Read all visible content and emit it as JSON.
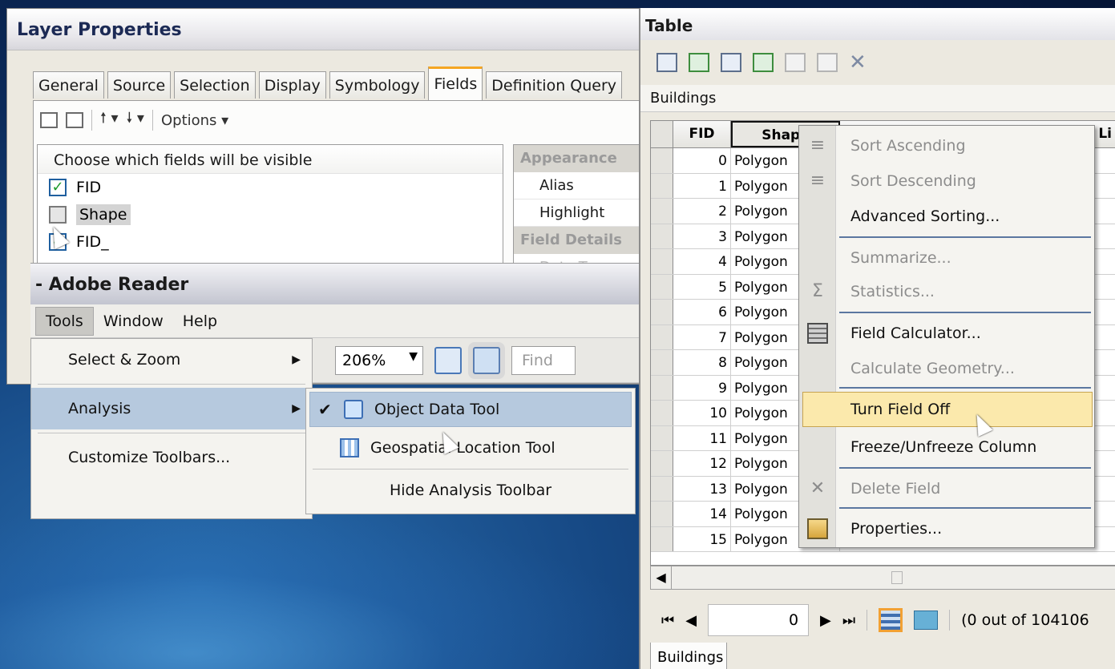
{
  "layer_properties": {
    "title": "Layer Properties",
    "tabs": [
      "General",
      "Source",
      "Selection",
      "Display",
      "Symbology",
      "Fields",
      "Definition Query"
    ],
    "active_tab": "Fields",
    "options_label": "Options ▾",
    "fields_header": "Choose which fields will be visible",
    "fields": [
      {
        "name": "FID",
        "checked": true
      },
      {
        "name": "Shape",
        "checked": false
      },
      {
        "name": "FID_",
        "checked": true
      }
    ],
    "props": {
      "appearance": "Appearance",
      "alias": "Alias",
      "highlight": "Highlight",
      "field_details": "Field Details",
      "data_type": "Data Type"
    }
  },
  "adobe_reader": {
    "title": "- Adobe Reader",
    "menus": [
      "Tools",
      "Window",
      "Help"
    ],
    "zoom": "206%",
    "find_placeholder": "Find",
    "tools_menu": [
      {
        "label": "Select & Zoom",
        "submenu": true
      },
      {
        "label": "Analysis",
        "submenu": true,
        "highlighted": true
      },
      {
        "label": "Customize Toolbars...",
        "submenu": false
      }
    ],
    "analysis_submenu": [
      {
        "label": "Object Data Tool",
        "checked": true,
        "highlighted": true
      },
      {
        "label": "Geospatial Location Tool",
        "checked": false
      },
      {
        "label": "Hide Analysis Toolbar",
        "checked": false
      }
    ]
  },
  "table": {
    "title": "Table",
    "layer_name": "Buildings",
    "columns": [
      "FID",
      "Shape",
      "",
      "",
      "Li"
    ],
    "rows": [
      {
        "fid": "0",
        "shape": "Polygon"
      },
      {
        "fid": "1",
        "shape": "Polygon"
      },
      {
        "fid": "2",
        "shape": "Polygon"
      },
      {
        "fid": "3",
        "shape": "Polygon"
      },
      {
        "fid": "4",
        "shape": "Polygon"
      },
      {
        "fid": "5",
        "shape": "Polygon"
      },
      {
        "fid": "6",
        "shape": "Polygon"
      },
      {
        "fid": "7",
        "shape": "Polygon"
      },
      {
        "fid": "8",
        "shape": "Polygon"
      },
      {
        "fid": "9",
        "shape": "Polygon"
      },
      {
        "fid": "10",
        "shape": "Polygon"
      },
      {
        "fid": "11",
        "shape": "Polygon"
      },
      {
        "fid": "12",
        "shape": "Polygon"
      },
      {
        "fid": "13",
        "shape": "Polygon"
      },
      {
        "fid": "14",
        "shape": "Polygon"
      },
      {
        "fid": "15",
        "shape": "Polygon"
      }
    ],
    "context_menu": [
      {
        "label": "Sort Ascending",
        "enabled": false
      },
      {
        "label": "Sort Descending",
        "enabled": false
      },
      {
        "label": "Advanced Sorting...",
        "enabled": true
      },
      {
        "label": "Summarize...",
        "enabled": false
      },
      {
        "label": "Statistics...",
        "enabled": false
      },
      {
        "label": "Field Calculator...",
        "enabled": true
      },
      {
        "label": "Calculate Geometry...",
        "enabled": false
      },
      {
        "label": "Turn Field Off",
        "enabled": true,
        "highlighted": true
      },
      {
        "label": "Freeze/Unfreeze Column",
        "enabled": true
      },
      {
        "label": "Delete Field",
        "enabled": false
      },
      {
        "label": "Properties...",
        "enabled": true
      }
    ],
    "current_record": "0",
    "record_count": "(0 out of 104106",
    "bottom_tab": "Buildings"
  },
  "colors": {
    "highlight_menu": "#b6c9de",
    "context_highlight": "#fbe9ac",
    "active_tab_accent": "#f5a623",
    "background_blue": "#0b2a5a"
  }
}
